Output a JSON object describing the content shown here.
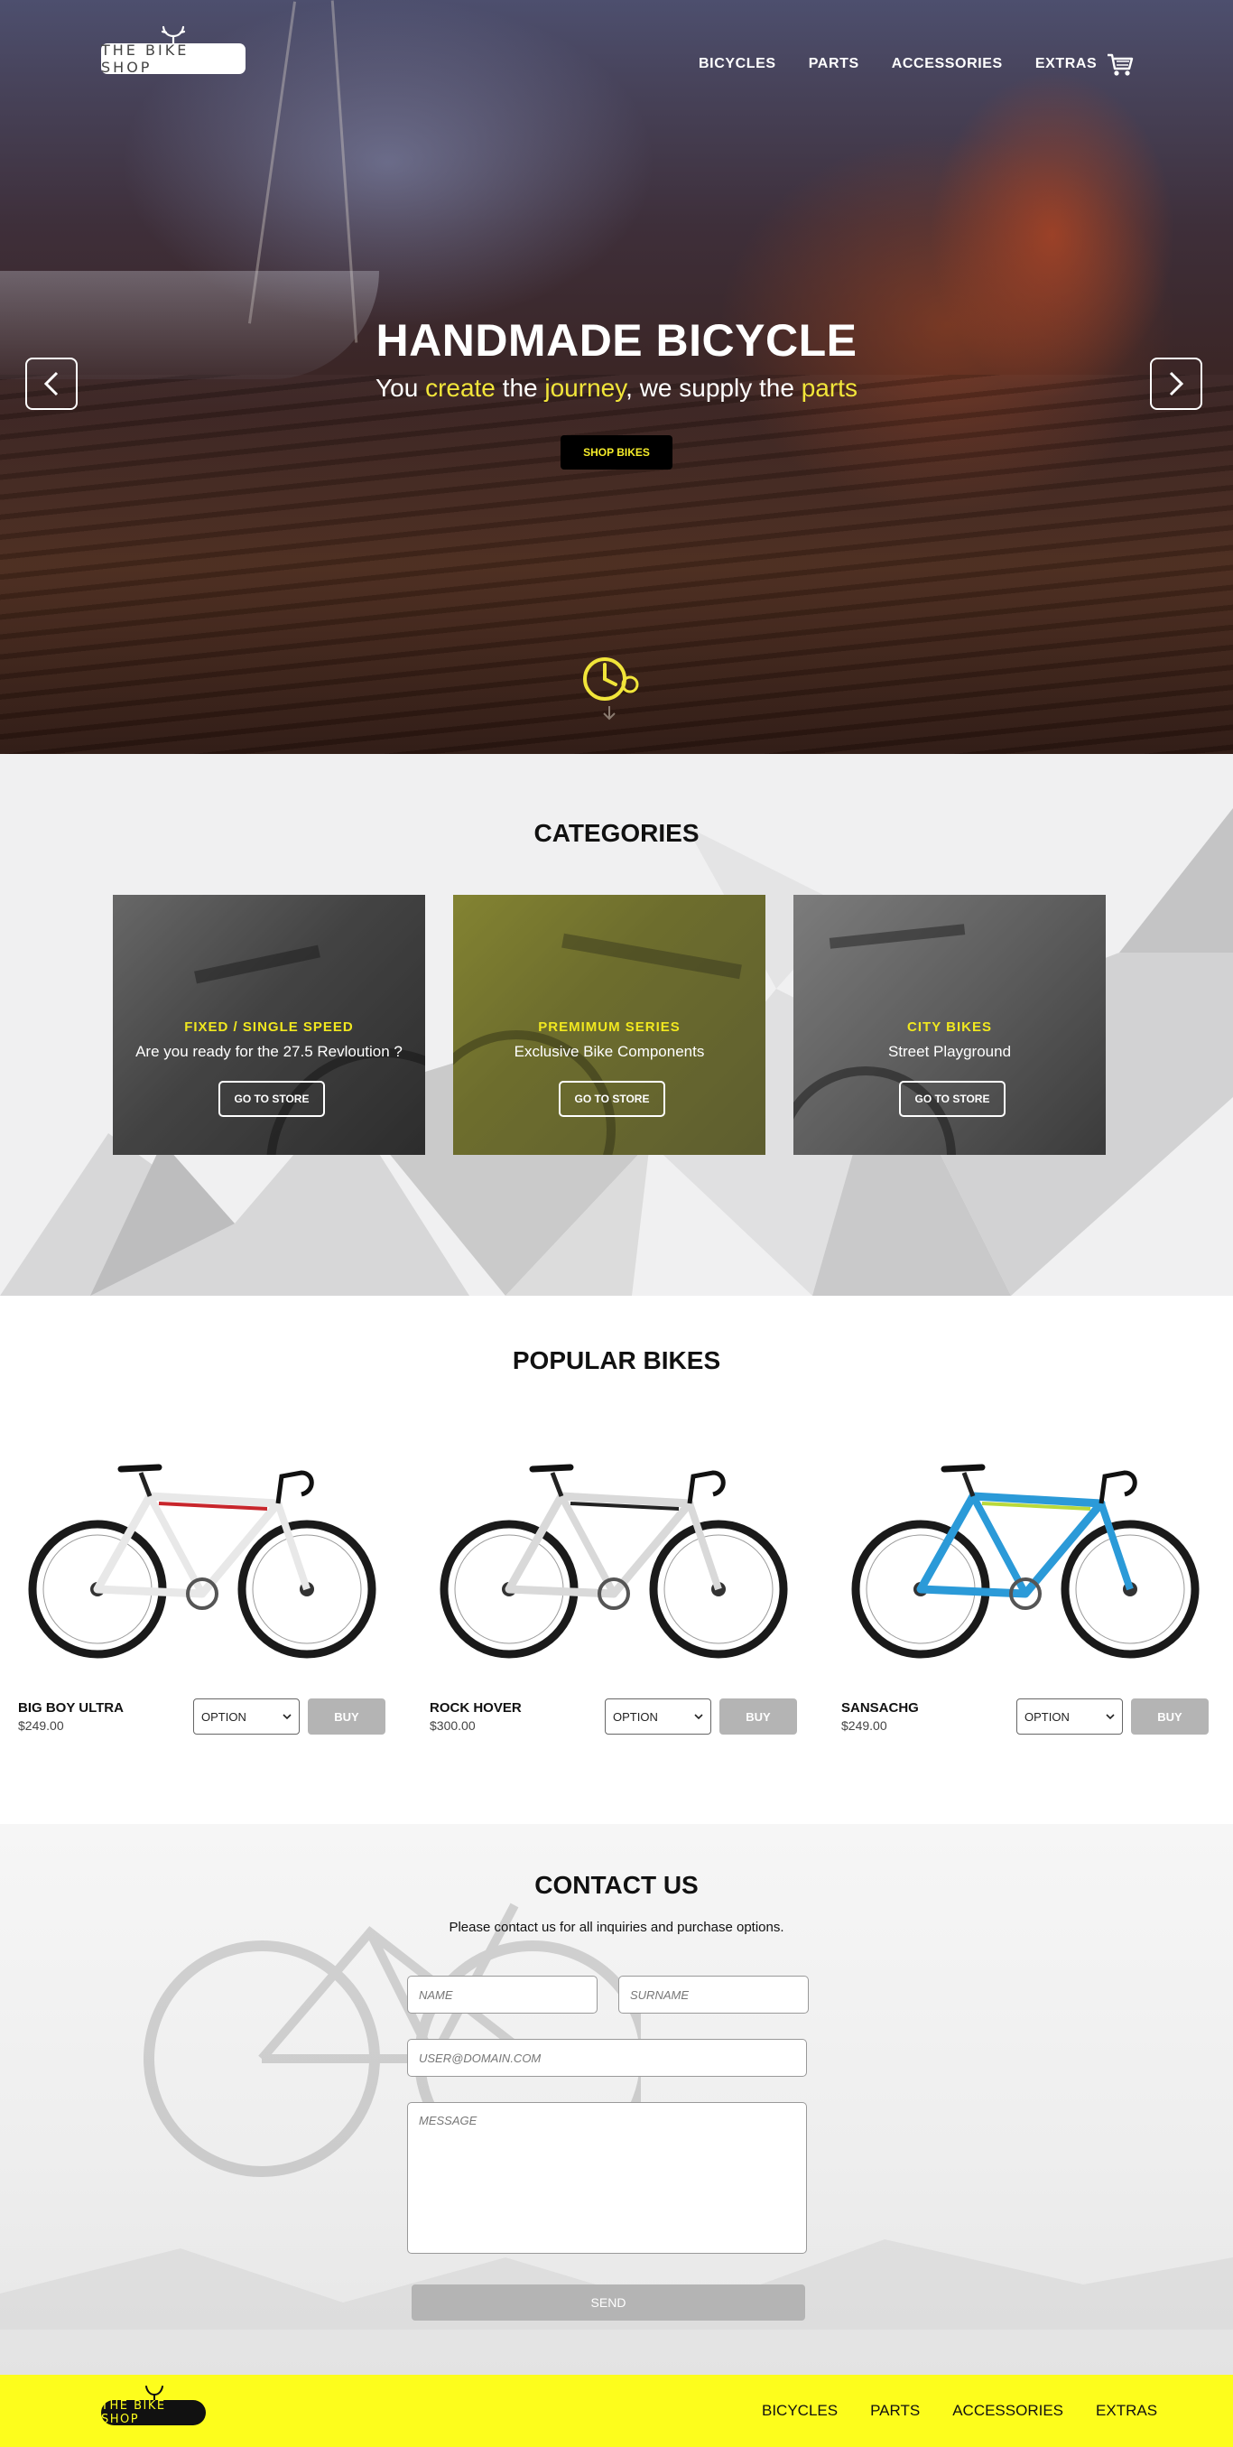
{
  "header": {
    "logo_text": "THE BIKE SHOP",
    "nav": [
      {
        "label": "BICYCLES"
      },
      {
        "label": "PARTS"
      },
      {
        "label": "ACCESSORIES"
      },
      {
        "label": "EXTRAS"
      }
    ],
    "cart_icon": "cart-icon"
  },
  "hero": {
    "title": "HANDMADE BICYCLE",
    "subtitle_parts": {
      "p1": "You ",
      "w1": "create",
      "p2": " the ",
      "w2": "journey",
      "p3": ", we supply the ",
      "w3": "parts"
    },
    "button_label": "SHOP BIKES",
    "highlight_color": "#f1e53a"
  },
  "categories": {
    "title": "CATEGORIES",
    "items": [
      {
        "title": "FIXED / SINGLE SPEED",
        "subtitle": "Are you ready for the 27.5 Revloution ?",
        "button": "GO TO STORE"
      },
      {
        "title": "PREMIMUM SERIES",
        "subtitle": "Exclusive Bike Components",
        "button": "GO TO STORE"
      },
      {
        "title": "CITY BIKES",
        "subtitle": "Street Playground",
        "button": "GO TO STORE"
      }
    ]
  },
  "popular": {
    "title": "POPULAR BIKES",
    "items": [
      {
        "name": "BIG BOY ULTRA",
        "price": "$249.00",
        "option": "OPTION",
        "buy": "BUY",
        "frame_color": "#e8e8e8",
        "accent_color": "#c8262c"
      },
      {
        "name": "ROCK HOVER",
        "price": "$300.00",
        "option": "OPTION",
        "buy": "BUY",
        "frame_color": "#d9d9d9",
        "accent_color": "#222222"
      },
      {
        "name": "SANSACHG",
        "price": "$249.00",
        "option": "OPTION",
        "buy": "BUY",
        "frame_color": "#2b9ad8",
        "accent_color": "#b9d93a"
      }
    ]
  },
  "contact": {
    "title": "CONTACT US",
    "subtitle": "Please contact us for all inquiries and purchase options.",
    "name_placeholder": "NAME",
    "surname_placeholder": "SURNAME",
    "email_placeholder": "USER@DOMAIN.COM",
    "message_placeholder": "MESSAGE",
    "send_label": "SEND"
  },
  "footer": {
    "logo_text": "THE BIKE SHOP",
    "nav": [
      {
        "label": "BICYCLES"
      },
      {
        "label": "PARTS"
      },
      {
        "label": "ACCESSORIES"
      },
      {
        "label": "EXTRAS"
      }
    ],
    "background_color": "#fdfd1c"
  }
}
